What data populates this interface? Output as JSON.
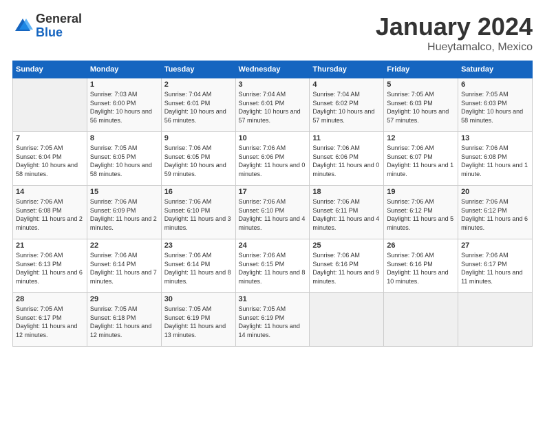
{
  "logo": {
    "general": "General",
    "blue": "Blue"
  },
  "header": {
    "month": "January 2024",
    "location": "Hueytamalco, Mexico"
  },
  "weekdays": [
    "Sunday",
    "Monday",
    "Tuesday",
    "Wednesday",
    "Thursday",
    "Friday",
    "Saturday"
  ],
  "weeks": [
    [
      {
        "day": "",
        "sunrise": "",
        "sunset": "",
        "daylight": ""
      },
      {
        "day": "1",
        "sunrise": "Sunrise: 7:03 AM",
        "sunset": "Sunset: 6:00 PM",
        "daylight": "Daylight: 10 hours and 56 minutes."
      },
      {
        "day": "2",
        "sunrise": "Sunrise: 7:04 AM",
        "sunset": "Sunset: 6:01 PM",
        "daylight": "Daylight: 10 hours and 56 minutes."
      },
      {
        "day": "3",
        "sunrise": "Sunrise: 7:04 AM",
        "sunset": "Sunset: 6:01 PM",
        "daylight": "Daylight: 10 hours and 57 minutes."
      },
      {
        "day": "4",
        "sunrise": "Sunrise: 7:04 AM",
        "sunset": "Sunset: 6:02 PM",
        "daylight": "Daylight: 10 hours and 57 minutes."
      },
      {
        "day": "5",
        "sunrise": "Sunrise: 7:05 AM",
        "sunset": "Sunset: 6:03 PM",
        "daylight": "Daylight: 10 hours and 57 minutes."
      },
      {
        "day": "6",
        "sunrise": "Sunrise: 7:05 AM",
        "sunset": "Sunset: 6:03 PM",
        "daylight": "Daylight: 10 hours and 58 minutes."
      }
    ],
    [
      {
        "day": "7",
        "sunrise": "Sunrise: 7:05 AM",
        "sunset": "Sunset: 6:04 PM",
        "daylight": "Daylight: 10 hours and 58 minutes."
      },
      {
        "day": "8",
        "sunrise": "Sunrise: 7:05 AM",
        "sunset": "Sunset: 6:05 PM",
        "daylight": "Daylight: 10 hours and 58 minutes."
      },
      {
        "day": "9",
        "sunrise": "Sunrise: 7:06 AM",
        "sunset": "Sunset: 6:05 PM",
        "daylight": "Daylight: 10 hours and 59 minutes."
      },
      {
        "day": "10",
        "sunrise": "Sunrise: 7:06 AM",
        "sunset": "Sunset: 6:06 PM",
        "daylight": "Daylight: 11 hours and 0 minutes."
      },
      {
        "day": "11",
        "sunrise": "Sunrise: 7:06 AM",
        "sunset": "Sunset: 6:06 PM",
        "daylight": "Daylight: 11 hours and 0 minutes."
      },
      {
        "day": "12",
        "sunrise": "Sunrise: 7:06 AM",
        "sunset": "Sunset: 6:07 PM",
        "daylight": "Daylight: 11 hours and 1 minute."
      },
      {
        "day": "13",
        "sunrise": "Sunrise: 7:06 AM",
        "sunset": "Sunset: 6:08 PM",
        "daylight": "Daylight: 11 hours and 1 minute."
      }
    ],
    [
      {
        "day": "14",
        "sunrise": "Sunrise: 7:06 AM",
        "sunset": "Sunset: 6:08 PM",
        "daylight": "Daylight: 11 hours and 2 minutes."
      },
      {
        "day": "15",
        "sunrise": "Sunrise: 7:06 AM",
        "sunset": "Sunset: 6:09 PM",
        "daylight": "Daylight: 11 hours and 2 minutes."
      },
      {
        "day": "16",
        "sunrise": "Sunrise: 7:06 AM",
        "sunset": "Sunset: 6:10 PM",
        "daylight": "Daylight: 11 hours and 3 minutes."
      },
      {
        "day": "17",
        "sunrise": "Sunrise: 7:06 AM",
        "sunset": "Sunset: 6:10 PM",
        "daylight": "Daylight: 11 hours and 4 minutes."
      },
      {
        "day": "18",
        "sunrise": "Sunrise: 7:06 AM",
        "sunset": "Sunset: 6:11 PM",
        "daylight": "Daylight: 11 hours and 4 minutes."
      },
      {
        "day": "19",
        "sunrise": "Sunrise: 7:06 AM",
        "sunset": "Sunset: 6:12 PM",
        "daylight": "Daylight: 11 hours and 5 minutes."
      },
      {
        "day": "20",
        "sunrise": "Sunrise: 7:06 AM",
        "sunset": "Sunset: 6:12 PM",
        "daylight": "Daylight: 11 hours and 6 minutes."
      }
    ],
    [
      {
        "day": "21",
        "sunrise": "Sunrise: 7:06 AM",
        "sunset": "Sunset: 6:13 PM",
        "daylight": "Daylight: 11 hours and 6 minutes."
      },
      {
        "day": "22",
        "sunrise": "Sunrise: 7:06 AM",
        "sunset": "Sunset: 6:14 PM",
        "daylight": "Daylight: 11 hours and 7 minutes."
      },
      {
        "day": "23",
        "sunrise": "Sunrise: 7:06 AM",
        "sunset": "Sunset: 6:14 PM",
        "daylight": "Daylight: 11 hours and 8 minutes."
      },
      {
        "day": "24",
        "sunrise": "Sunrise: 7:06 AM",
        "sunset": "Sunset: 6:15 PM",
        "daylight": "Daylight: 11 hours and 8 minutes."
      },
      {
        "day": "25",
        "sunrise": "Sunrise: 7:06 AM",
        "sunset": "Sunset: 6:16 PM",
        "daylight": "Daylight: 11 hours and 9 minutes."
      },
      {
        "day": "26",
        "sunrise": "Sunrise: 7:06 AM",
        "sunset": "Sunset: 6:16 PM",
        "daylight": "Daylight: 11 hours and 10 minutes."
      },
      {
        "day": "27",
        "sunrise": "Sunrise: 7:06 AM",
        "sunset": "Sunset: 6:17 PM",
        "daylight": "Daylight: 11 hours and 11 minutes."
      }
    ],
    [
      {
        "day": "28",
        "sunrise": "Sunrise: 7:05 AM",
        "sunset": "Sunset: 6:17 PM",
        "daylight": "Daylight: 11 hours and 12 minutes."
      },
      {
        "day": "29",
        "sunrise": "Sunrise: 7:05 AM",
        "sunset": "Sunset: 6:18 PM",
        "daylight": "Daylight: 11 hours and 12 minutes."
      },
      {
        "day": "30",
        "sunrise": "Sunrise: 7:05 AM",
        "sunset": "Sunset: 6:19 PM",
        "daylight": "Daylight: 11 hours and 13 minutes."
      },
      {
        "day": "31",
        "sunrise": "Sunrise: 7:05 AM",
        "sunset": "Sunset: 6:19 PM",
        "daylight": "Daylight: 11 hours and 14 minutes."
      },
      {
        "day": "",
        "sunrise": "",
        "sunset": "",
        "daylight": ""
      },
      {
        "day": "",
        "sunrise": "",
        "sunset": "",
        "daylight": ""
      },
      {
        "day": "",
        "sunrise": "",
        "sunset": "",
        "daylight": ""
      }
    ]
  ]
}
